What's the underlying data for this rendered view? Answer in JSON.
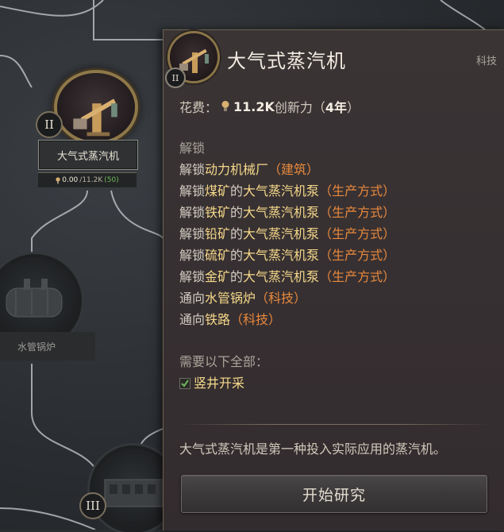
{
  "tech_tree": {
    "selected_node": {
      "tier": "II",
      "label": "大气式蒸汽机",
      "progress_current": "0.00",
      "progress_sep": "/11.2K",
      "turns": "(50)"
    },
    "other_nodes": [
      {
        "label": "水管锅炉"
      },
      {
        "tier": "III"
      }
    ]
  },
  "tooltip": {
    "tier": "II",
    "title": "大气式蒸汽机",
    "category": "科技",
    "cost_label": "花费：",
    "cost_value": "11.2K",
    "cost_unit": "创新力（",
    "cost_time": "4年",
    "cost_close": "）",
    "unlocks_heading": "解锁",
    "unlocks": [
      {
        "prefix": "解锁",
        "target": "动力机械厂",
        "kind": "（建筑）"
      },
      {
        "prefix": "解锁",
        "target": "煤矿",
        "mid": "的",
        "target2": "大气蒸汽机泵",
        "kind": "（生产方式）"
      },
      {
        "prefix": "解锁",
        "target": "铁矿",
        "mid": "的",
        "target2": "大气蒸汽机泵",
        "kind": "（生产方式）"
      },
      {
        "prefix": "解锁",
        "target": "铅矿",
        "mid": "的",
        "target2": "大气蒸汽机泵",
        "kind": "（生产方式）"
      },
      {
        "prefix": "解锁",
        "target": "硫矿",
        "mid": "的",
        "target2": "大气蒸汽机泵",
        "kind": "（生产方式）"
      },
      {
        "prefix": "解锁",
        "target": "金矿",
        "mid": "的",
        "target2": "大气蒸汽机泵",
        "kind": "（生产方式）"
      },
      {
        "prefix": "通向",
        "target": "水管锅炉",
        "kind": "（科技）"
      },
      {
        "prefix": "通向",
        "target": "铁路",
        "kind": "（科技）"
      }
    ],
    "requires_heading": "需要以下全部：",
    "requirement": "竖井开采",
    "description": "大气式蒸汽机是第一种投入实际应用的蒸汽机。",
    "research_button": "开始研究"
  },
  "colors": {
    "highlight": "#f6d98a",
    "link_orange": "#e8893c",
    "check_green": "#6dba5c"
  }
}
